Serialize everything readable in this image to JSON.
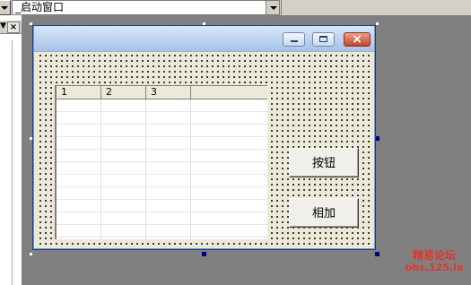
{
  "toolbar": {
    "combo_value": "_启动窗口"
  },
  "leftpanel": {
    "close": "×"
  },
  "form": {
    "titlebar": {
      "min": "minimize",
      "max": "maximize",
      "close": "×"
    },
    "grid": {
      "headers": [
        "1",
        "2",
        "3",
        ""
      ]
    },
    "buttons": {
      "button1_label": "按钮",
      "button2_label": "相加"
    }
  },
  "watermark": {
    "line1": "精易论坛",
    "line2": "bbs.125.la"
  }
}
